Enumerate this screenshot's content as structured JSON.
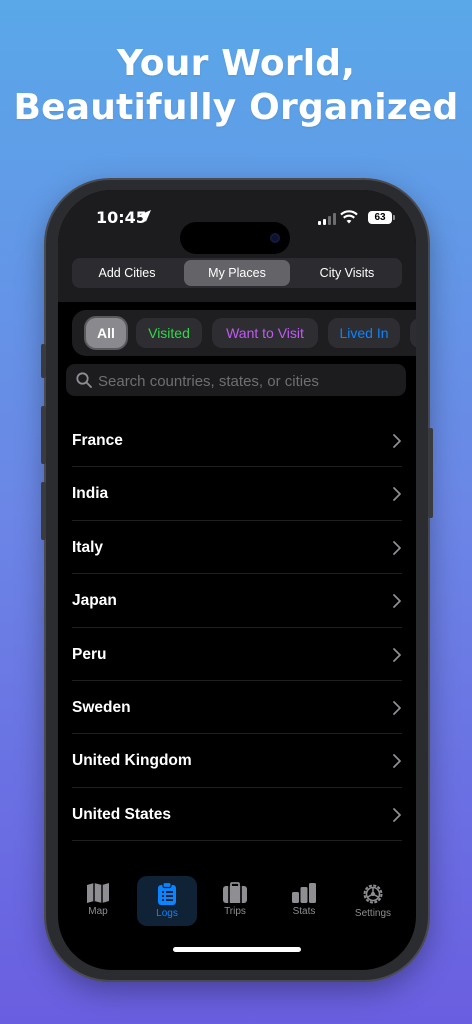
{
  "headline": {
    "line1": "Your World,",
    "line2": "Beautifully Organized"
  },
  "status_bar": {
    "time": "10:45",
    "battery": "63"
  },
  "segmented": {
    "add_cities": "Add Cities",
    "my_places": "My Places",
    "city_visits": "City Visits",
    "selected": "My Places"
  },
  "filters": {
    "all": "All",
    "visited": "Visited",
    "want_to_visit": "Want to Visit",
    "lived_in": "Lived In"
  },
  "search": {
    "placeholder": "Search countries, states, or cities",
    "value": ""
  },
  "places": [
    "France",
    "India",
    "Italy",
    "Japan",
    "Peru",
    "Sweden",
    "United Kingdom",
    "United States"
  ],
  "tabs": {
    "map": "Map",
    "logs": "Logs",
    "trips": "Trips",
    "stats": "Stats",
    "settings": "Settings",
    "active": "Logs"
  },
  "colors": {
    "visited": "#32d74b",
    "want_to_visit": "#bf5af2",
    "lived_in": "#0a84ff",
    "accent": "#0a84ff"
  }
}
